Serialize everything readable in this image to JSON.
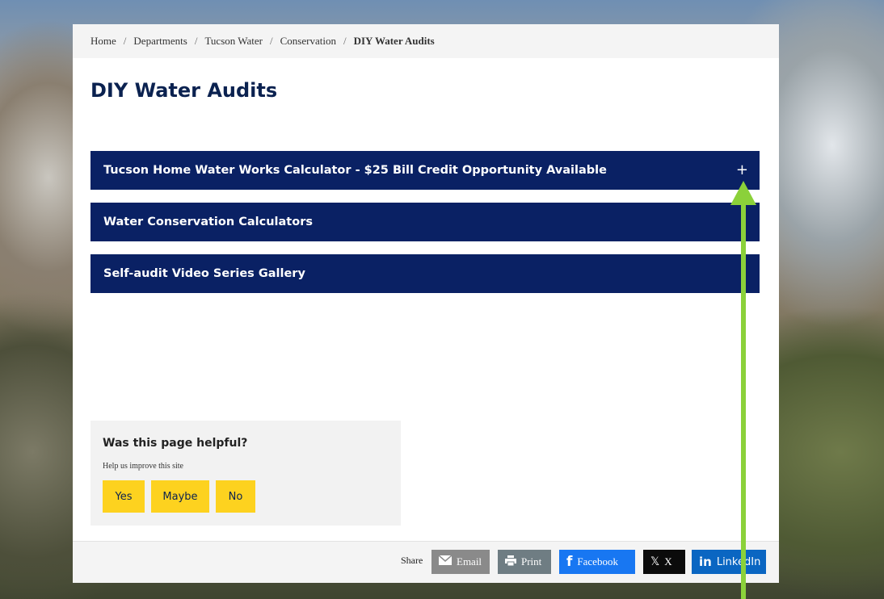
{
  "breadcrumb": {
    "items": [
      "Home",
      "Departments",
      "Tucson Water",
      "Conservation"
    ],
    "separator": "/",
    "current": "DIY Water Audits"
  },
  "page": {
    "title": "DIY Water Audits"
  },
  "accordion": {
    "items": [
      {
        "label": "Tucson Home Water Works Calculator - $25 Bill Credit Opportunity Available",
        "icon": "+"
      },
      {
        "label": "Water Conservation Calculators"
      },
      {
        "label": "Self-audit Video Series Gallery"
      }
    ]
  },
  "feedback": {
    "question": "Was this page helpful?",
    "subtitle": "Help us improve this site",
    "yes": "Yes",
    "maybe": "Maybe",
    "no": "No"
  },
  "share": {
    "label": "Share",
    "email": "Email",
    "print": "Print",
    "facebook": "Facebook",
    "x": "X",
    "linkedin": "LinkedIn"
  },
  "colors": {
    "accordion_bg": "#0a2164",
    "title": "#0b2250",
    "feedback_button": "#fdd21f",
    "annotation_arrow": "#8bd13a"
  }
}
